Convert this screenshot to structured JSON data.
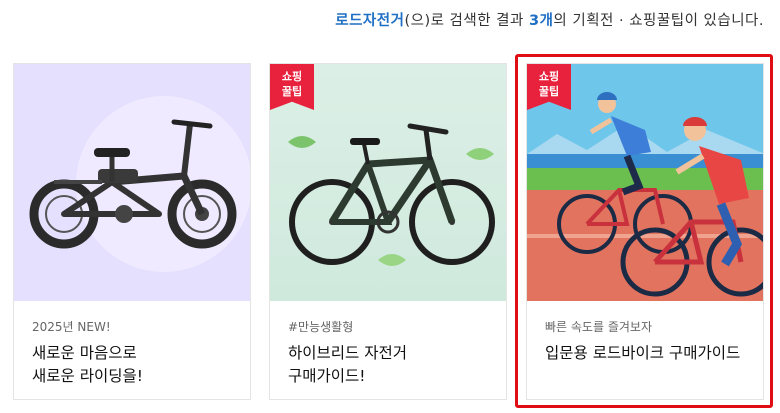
{
  "summary": {
    "keyword": "로드자전거",
    "paren_text": "(으)로 검색한 결과 ",
    "count": "3개",
    "tail_text": "의 기획전 · 쇼핑꿀팁이 있습니다."
  },
  "cards": [
    {
      "badge": "",
      "subtitle": "2025년 NEW!",
      "title_lines": [
        "새로운 마음으로",
        "새로운 라이딩을!"
      ]
    },
    {
      "badge_line1": "쇼핑",
      "badge_line2": "꿀팁",
      "subtitle": "#만능생활형",
      "title_lines": [
        "하이브리드 자전거",
        "구매가이드!"
      ]
    },
    {
      "badge_line1": "쇼핑",
      "badge_line2": "꿀팁",
      "subtitle": "빠른 속도를 즐겨보자",
      "title_lines": [
        "입문용 로드바이크 구매가이드"
      ]
    }
  ],
  "colors": {
    "accent": "#1f6fc4",
    "badge": "#e8213c",
    "highlight": "#e00e14"
  }
}
